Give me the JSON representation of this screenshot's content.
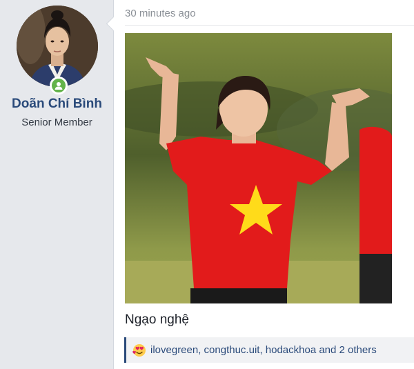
{
  "user": {
    "name": "Doãn Chí Bình",
    "title": "Senior Member",
    "online": true
  },
  "post": {
    "timestamp": "30 minutes ago",
    "message": "Ngạo nghệ",
    "media_icon": "animated-gif-image"
  },
  "reactions": {
    "icon": "love-reaction-icon",
    "text": "ilovegreen, congthuc.uit, hodackhoa and 2 others"
  },
  "colors": {
    "username": "#2a4a7a",
    "online": "#63b34a",
    "reaction_border": "#2a4a7a",
    "shirt": "#e21b1b",
    "star": "#ffdb1a"
  }
}
